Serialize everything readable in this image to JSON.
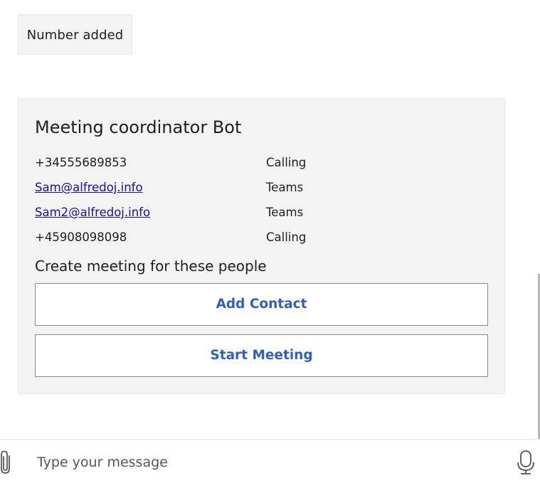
{
  "messages": {
    "user_bubble": "Number added"
  },
  "card": {
    "title": "Meeting coordinator Bot",
    "contacts": [
      {
        "contact": "+34555689853",
        "method": "Calling"
      },
      {
        "contact": "Sam@alfredoj.info",
        "method": "Teams"
      },
      {
        "contact": "Sam2@alfredoj.info",
        "method": "Teams"
      },
      {
        "contact": "+45908098098",
        "method": "Calling"
      }
    ],
    "prompt": "Create meeting for these people",
    "add_contact_label": "Add Contact",
    "start_meeting_label": "Start Meeting"
  },
  "composer": {
    "placeholder": "Type your message",
    "attach_icon": "paperclip-icon",
    "mic_icon": "microphone-icon"
  },
  "colors": {
    "link": "#1a0dab",
    "button_text": "#2f5fc4",
    "card_background": "#f3f3f3"
  }
}
